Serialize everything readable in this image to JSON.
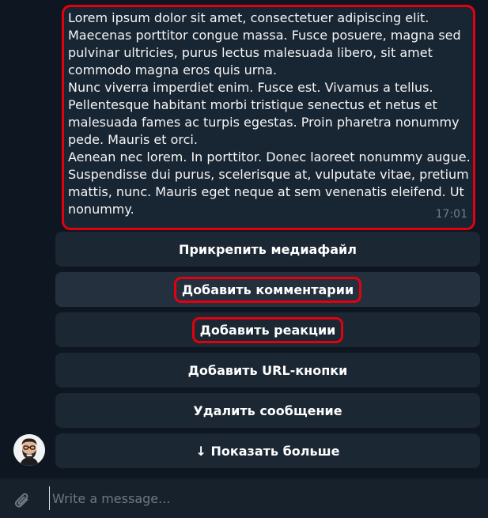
{
  "message": {
    "text": "Lorem ipsum dolor sit amet, consectetuer adipiscing elit.\nMaecenas porttitor congue massa. Fusce posuere, magna sed\npulvinar ultricies, purus lectus malesuada libero, sit amet\ncommodo magna eros quis urna.\nNunc viverra imperdiet enim. Fusce est. Vivamus a tellus.\nPellentesque habitant morbi tristique senectus et netus et\nmalesuada fames ac turpis egestas. Proin pharetra nonummy\npede. Mauris et orci.\nAenean nec lorem. In porttitor. Donec laoreet nonummy augue.\nSuspendisse dui purus, scelerisque at, vulputate vitae, pretium\nmattis, nunc. Mauris eget neque at sem venenatis eleifend. Ut\nnonummy.",
    "time": "17:01"
  },
  "keyboard": {
    "attach_media": "Прикрепить медиафайл",
    "add_comments": "Добавить комментарии",
    "add_reactions": "Добавить реакции",
    "add_url_buttons": "Добавить URL-кнопки",
    "delete_message": "Удалить сообщение",
    "show_more": "↓ Показать больше"
  },
  "composer": {
    "placeholder": "Write a message...",
    "attach_icon": "paperclip-icon"
  },
  "colors": {
    "chat_background": "#0e1621",
    "bubble": "#182533",
    "button": "#1c2734",
    "highlight": "#e3000f"
  }
}
